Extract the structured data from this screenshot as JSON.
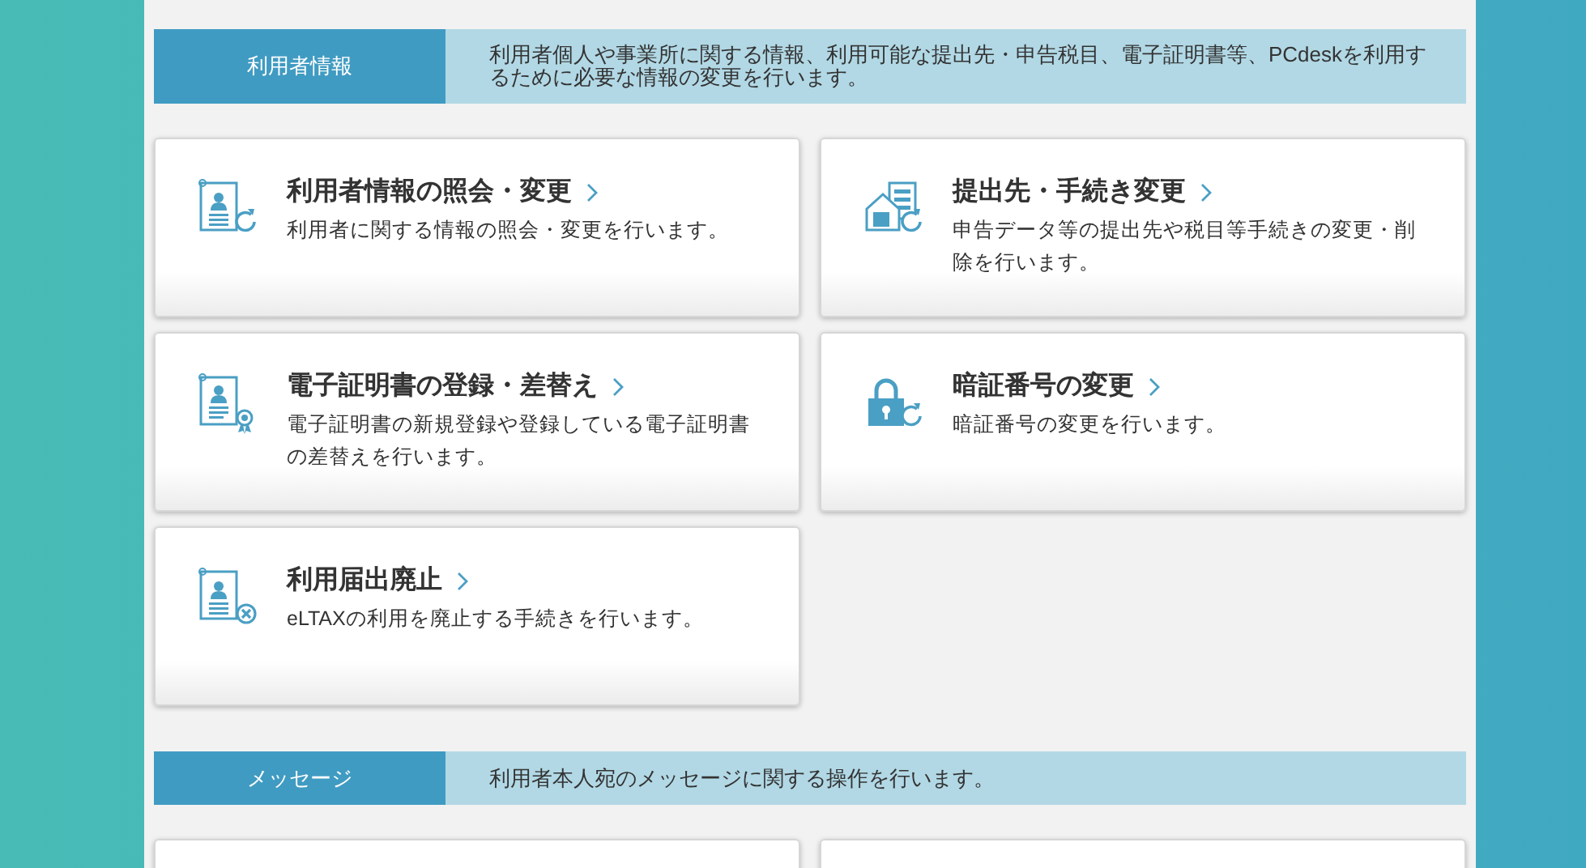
{
  "sections": [
    {
      "label": "利用者情報",
      "description": "利用者個人や事業所に関する情報、利用可能な提出先・申告税目、電子証明書等、PCdeskを利用するために必要な情報の変更を行います。",
      "cards": [
        {
          "kind": "person-refresh",
          "title": "利用者情報の照会・変更",
          "description": "利用者に関する情報の照会・変更を行います。"
        },
        {
          "kind": "house-refresh",
          "title": "提出先・手続き変更",
          "description": "申告データ等の提出先や税目等手続きの変更・削除を行います。"
        },
        {
          "kind": "certificate",
          "title": "電子証明書の登録・差替え",
          "description": "電子証明書の新規登録や登録している電子証明書の差替えを行います。"
        },
        {
          "kind": "lock-refresh",
          "title": "暗証番号の変更",
          "description": "暗証番号の変更を行います。"
        },
        {
          "kind": "person-remove",
          "title": "利用届出廃止",
          "description": "eLTAXの利用を廃止する手続きを行います。"
        }
      ]
    },
    {
      "label": "メッセージ",
      "description": "利用者本人宛のメッセージに関する操作を行います。",
      "cards": [
        {
          "kind": "blank"
        },
        {
          "kind": "blank"
        }
      ]
    }
  ]
}
